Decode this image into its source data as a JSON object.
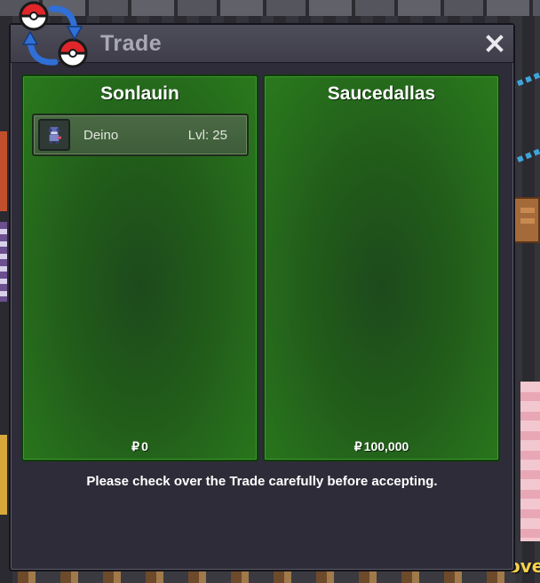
{
  "window": {
    "title": "Trade",
    "close_icon": "close-icon"
  },
  "trade_logo_icon": "trade-swap-icon",
  "left_panel": {
    "player_name": "Sonlauin",
    "money_symbol": "₽",
    "money": "0",
    "pokemon": [
      {
        "icon": "deino-icon",
        "name": "Deino",
        "level": "Lvl: 25"
      }
    ]
  },
  "right_panel": {
    "player_name": "Saucedallas",
    "money_symbol": "₽",
    "money": "100,000",
    "pokemon": []
  },
  "notice": "Please check over the Trade carefully before accepting.",
  "background_text": "ove",
  "colors": {
    "panel_green": "#2a7a1d",
    "window_bg": "#2d2c38",
    "titlebar": "#4e4d5a"
  }
}
